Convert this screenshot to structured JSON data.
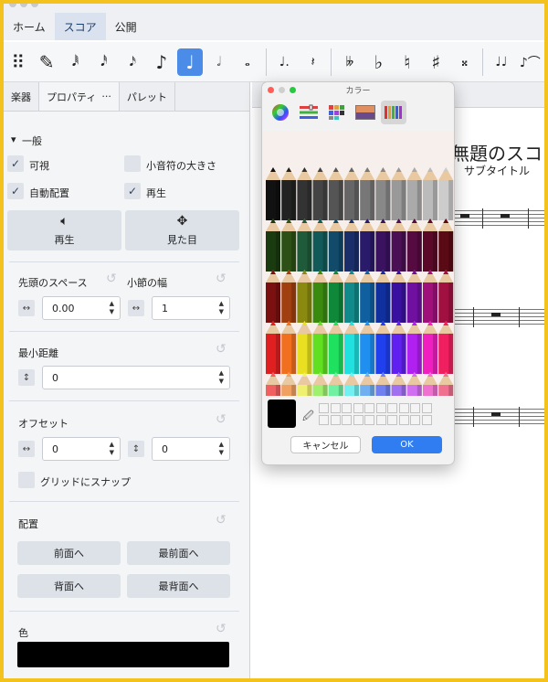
{
  "nav": {
    "tabs": [
      "ホーム",
      "スコア",
      "公開"
    ],
    "active": 1
  },
  "toolbar": {
    "items": [
      {
        "name": "toolbar-grip-icon",
        "glyph": "⠿"
      },
      {
        "name": "note-input-pencil-icon",
        "glyph": "✎"
      },
      {
        "name": "note-64th-icon",
        "glyph": "𝅘𝅥𝅱"
      },
      {
        "name": "note-32nd-icon",
        "glyph": "𝅘𝅥𝅰"
      },
      {
        "name": "note-16th-icon",
        "glyph": "𝅘𝅥𝅯"
      },
      {
        "name": "note-eighth-icon",
        "glyph": "♪"
      },
      {
        "name": "note-quarter-icon",
        "glyph": "♩",
        "active": true
      },
      {
        "name": "note-half-icon",
        "glyph": "𝅗𝅥"
      },
      {
        "name": "note-whole-icon",
        "glyph": "𝅝"
      },
      {
        "sep": true
      },
      {
        "name": "augmentation-dot-icon",
        "glyph": "♩."
      },
      {
        "name": "rest-icon",
        "glyph": "𝄽"
      },
      {
        "sep": true
      },
      {
        "name": "double-flat-icon",
        "glyph": "𝄫"
      },
      {
        "name": "flat-icon",
        "glyph": "♭"
      },
      {
        "name": "natural-icon",
        "glyph": "♮"
      },
      {
        "name": "sharp-icon",
        "glyph": "♯"
      },
      {
        "name": "double-sharp-icon",
        "glyph": "𝄪"
      },
      {
        "sep": true
      },
      {
        "name": "tie-icon",
        "glyph": "♩♩"
      },
      {
        "name": "slur-icon",
        "glyph": "♪⌒"
      }
    ]
  },
  "panel": {
    "tabs": [
      "楽器",
      "プロパティ",
      "パレット"
    ],
    "more": "···",
    "general": {
      "title": "一般",
      "visible": "可視",
      "cue_size": "小音符の大きさ",
      "auto_place": "自動配置",
      "play": "再生"
    },
    "buttons": {
      "playback": "再生",
      "appearance": "見た目"
    },
    "leading_space": {
      "label": "先頭のスペース",
      "value": "0.00"
    },
    "measure_width": {
      "label": "小節の幅",
      "value": "1"
    },
    "min_distance": {
      "label": "最小距離",
      "value": "0"
    },
    "offset": {
      "label": "オフセット",
      "x": "0",
      "y": "0"
    },
    "snap_grid": "グリッドにスナップ",
    "arrange": {
      "label": "配置",
      "forward": "前面へ",
      "to_front": "最前面へ",
      "backward": "背面へ",
      "to_back": "最背面へ"
    },
    "color": {
      "label": "色",
      "value": "#000000"
    }
  },
  "score": {
    "title": "無題のスコア",
    "subtitle": "サブタイトル"
  },
  "color_dialog": {
    "title": "カラー",
    "cancel": "キャンセル",
    "ok": "OK",
    "selected_color": "#000000",
    "tools": [
      "color-wheel-icon",
      "color-sliders-icon",
      "color-palettes-icon",
      "image-palettes-icon",
      "pencils-icon"
    ],
    "pencil_rows": [
      [
        "#111111",
        "#222222",
        "#333333",
        "#444444",
        "#555555",
        "#666666",
        "#777777",
        "#888888",
        "#999999",
        "#aaaaaa",
        "#bbbbbb",
        "#cccccc"
      ],
      [
        "#1a3a10",
        "#2d5016",
        "#1f5a3a",
        "#125a5a",
        "#124a6a",
        "#1a2f6a",
        "#2a1a6a",
        "#3a1260",
        "#4a0f55",
        "#550a40",
        "#5a0a28",
        "#5a0a14"
      ],
      [
        "#7a1010",
        "#a04010",
        "#8a8a10",
        "#3a8a10",
        "#10883a",
        "#108a8a",
        "#1060a0",
        "#1030a0",
        "#3a10a0",
        "#7010a0",
        "#a0107a",
        "#a01040"
      ],
      [
        "#e02020",
        "#f07020",
        "#e8e020",
        "#60e020",
        "#20e060",
        "#20e0e0",
        "#2090f0",
        "#2040f0",
        "#6020f0",
        "#b020f0",
        "#f020c0",
        "#f02060"
      ],
      [
        "#f06060",
        "#f0a060",
        "#f0f070",
        "#a0f070",
        "#70f0a0",
        "#70f0f0",
        "#70b0f0",
        "#7080f0",
        "#a070f0",
        "#d070f0",
        "#f070d0",
        "#f07090"
      ]
    ]
  }
}
